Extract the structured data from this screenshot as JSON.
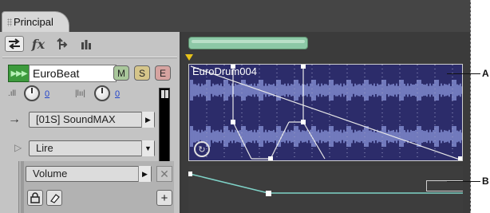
{
  "panel": {
    "tab_label": "Principal"
  },
  "toolbar": {
    "io_icon": "in-out-arrows-icon",
    "fx_label": "fx",
    "sends_icon": "sends-icon",
    "eq_icon": "eq-bars-icon"
  },
  "track": {
    "name": "EuroBeat",
    "mute_label": "M",
    "solo_label": "S",
    "arm_label": "E",
    "volume_value": "0",
    "pan_value": "0"
  },
  "input": {
    "device": "[01S] SoundMAX"
  },
  "automation": {
    "mode": "Lire",
    "parameter": "Volume"
  },
  "clip": {
    "name": "EuroDrum004"
  },
  "callouts": {
    "a": "A",
    "b": "B"
  },
  "colors": {
    "clip_bg": "#2c2c6a",
    "waveform": "#8f9be0",
    "envelope": "#7fd3c8",
    "timeline_scroll": "#8cc8a6",
    "cursor": "#e6c21a"
  }
}
